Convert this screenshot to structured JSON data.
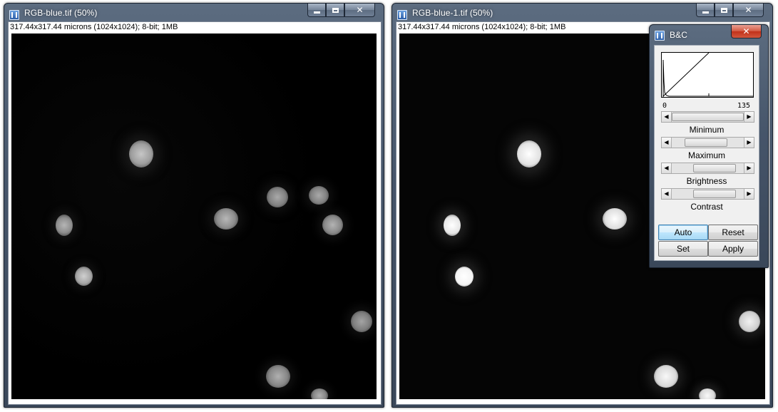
{
  "windows": [
    {
      "title": "RGB-blue.tif (50%)",
      "info": "317.44x317.44 microns (1024x1024); 8-bit; 1MB"
    },
    {
      "title": "RGB-blue-1.tif (50%)",
      "info": "317.44x317.44 microns (1024x1024); 8-bit; 1MB"
    }
  ],
  "window_controls": {
    "minimize_icon": "minimize-icon",
    "maximize_icon": "maximize-icon",
    "close_icon": "close-icon",
    "close_glyph": "✕"
  },
  "bc_dialog": {
    "title": "B&C",
    "histogram": {
      "min_label": "0",
      "max_label": "135"
    },
    "sliders": [
      {
        "label": "Minimum",
        "level": 0.0
      },
      {
        "label": "Maximum",
        "level": 0.45
      },
      {
        "label": "Brightness",
        "level": 0.74
      },
      {
        "label": "Contrast",
        "level": 0.74
      }
    ],
    "buttons": {
      "auto": "Auto",
      "reset": "Reset",
      "set": "Set",
      "apply": "Apply"
    }
  },
  "colors": {
    "title_bar": "#46556a",
    "close_button": "#c1311a",
    "image_background": "#000000"
  }
}
